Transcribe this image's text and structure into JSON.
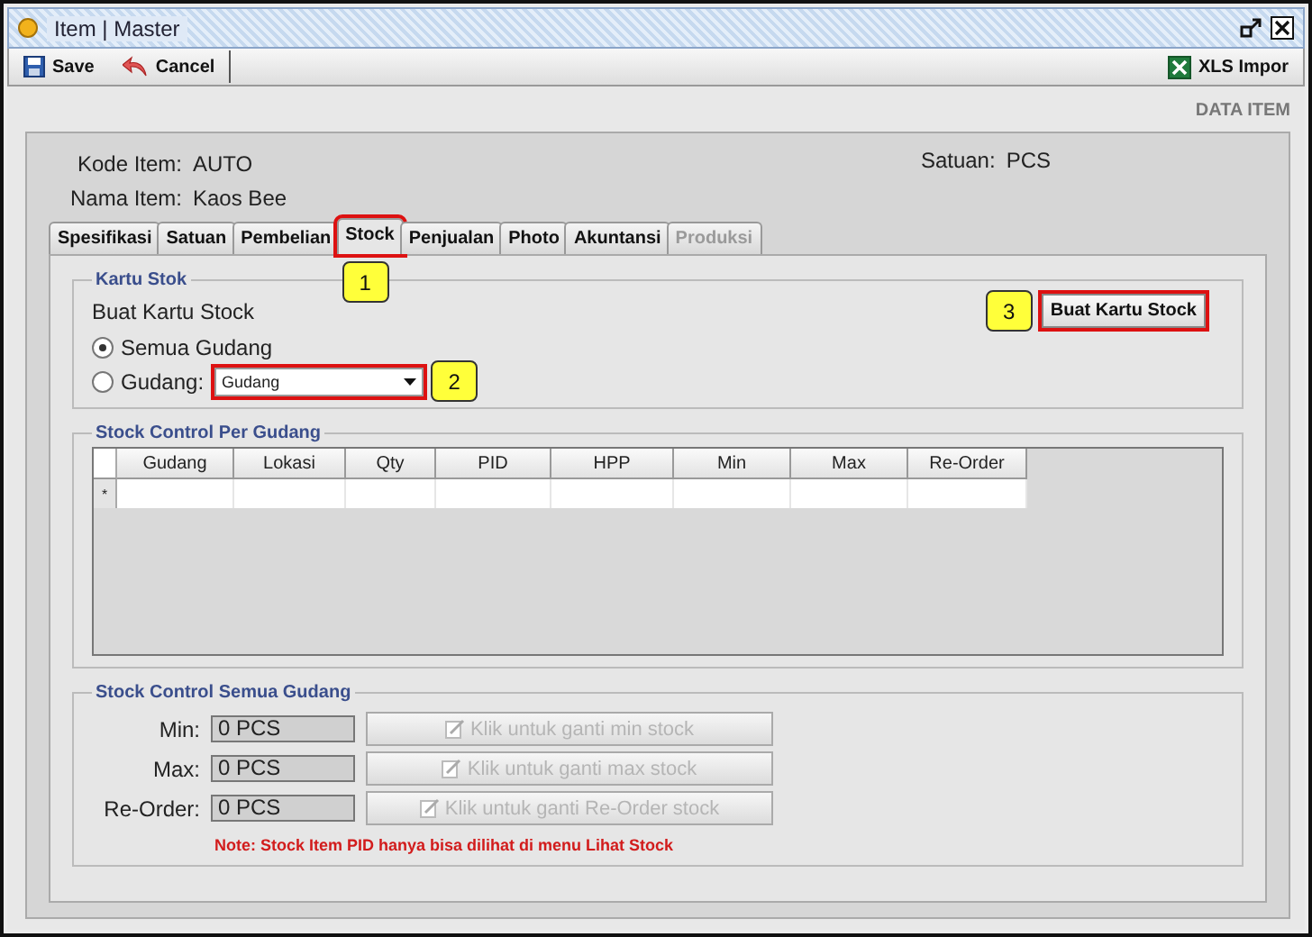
{
  "window": {
    "title": "Item | Master"
  },
  "toolbar": {
    "left": [
      {
        "kind": "save",
        "label": "Save"
      },
      {
        "kind": "cancel",
        "label": "Cancel"
      }
    ],
    "right": [
      {
        "kind": "excel",
        "label": "XLS Impor"
      }
    ]
  },
  "section_title": "DATA ITEM",
  "fields": [
    {
      "label": "Kode Item:",
      "value": "AUTO"
    },
    {
      "label": "Nama Item:",
      "value": "Kaos Bee"
    }
  ],
  "unit": {
    "label": "Satuan:",
    "value": "PCS"
  },
  "tabs": [
    {
      "label": "Spesifikasi",
      "selected": false,
      "disabled": false
    },
    {
      "label": "Satuan",
      "selected": false,
      "disabled": false
    },
    {
      "label": "Pembelian",
      "selected": false,
      "disabled": false
    },
    {
      "label": "Stock",
      "selected": true,
      "disabled": false,
      "callout": "1"
    },
    {
      "label": "Penjualan",
      "selected": false,
      "disabled": false
    },
    {
      "label": "Photo",
      "selected": false,
      "disabled": false
    },
    {
      "label": "Akuntansi",
      "selected": false,
      "disabled": false
    },
    {
      "label": "Produksi",
      "selected": false,
      "disabled": true
    }
  ],
  "stock_card": {
    "legend": "Kartu Stok",
    "caption": "Buat Kartu Stock",
    "button": {
      "label": "Buat Kartu Stock",
      "callout": "3"
    },
    "options": [
      {
        "label": "Semua Gudang",
        "selected": true
      },
      {
        "label": "Gudang:",
        "selected": false
      }
    ],
    "dropdown": {
      "value": "Gudang",
      "callout": "2"
    }
  },
  "per_warehouse": {
    "legend": "Stock Control Per Gudang",
    "row_marker": "*",
    "columns": [
      "Gudang",
      "Lokasi",
      "Qty",
      "PID",
      "HPP",
      "Min",
      "Max",
      "Re-Order"
    ]
  },
  "all_warehouses": {
    "legend": "Stock Control Semua Gudang",
    "rows": [
      {
        "label": "Min:",
        "value": "0 PCS",
        "button": "Klik untuk ganti min stock",
        "disabled": true
      },
      {
        "label": "Max:",
        "value": "0 PCS",
        "button": "Klik untuk ganti max stock",
        "disabled": true
      },
      {
        "label": "Re-Order:",
        "value": "0 PCS",
        "button": "Klik untuk ganti Re-Order stock",
        "disabled": true
      }
    ],
    "note": "Note: Stock Item PID hanya bisa dilihat di menu Lihat Stock"
  }
}
